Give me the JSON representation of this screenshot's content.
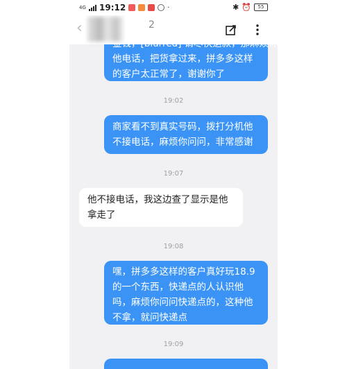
{
  "status_bar": {
    "network": "4G",
    "time": "19:12",
    "battery": "55",
    "icons": [
      "bluetooth-icon",
      "alarm-icon",
      "battery-icon"
    ]
  },
  "header": {
    "title": "2",
    "icons": [
      "back-icon",
      "share-icon",
      "more-icon"
    ]
  },
  "messages": [
    {
      "direction": "out",
      "lines": [
        "金钱，[blurred] 请尽快退款，那麻烦你打",
        "他电话，把货拿过来，拼多多这样",
        "的客户太正常了，谢谢你了"
      ]
    },
    {
      "timestamp": "19:02"
    },
    {
      "direction": "out",
      "lines": [
        "商家看不到真实号码，拨打分机他",
        "不接电话，麻烦你问问，非常感谢"
      ]
    },
    {
      "timestamp": "19:07"
    },
    {
      "direction": "in",
      "lines": [
        "他不接电话，我这边查了显示是他",
        "拿走了"
      ]
    },
    {
      "timestamp": "19:08"
    },
    {
      "direction": "out",
      "lines": [
        "嘿，拼多多这样的客户真好玩18.9",
        "的一个东西，快递点的人认识他",
        "吗，麻烦你问问快递点的，这种他",
        "不拿，就问快递点"
      ]
    },
    {
      "timestamp": "19:09"
    }
  ],
  "colors": {
    "outgoing_bubble": "#3b94f5",
    "incoming_bubble": "#ffffff",
    "chat_background": "#f1f1f4"
  }
}
